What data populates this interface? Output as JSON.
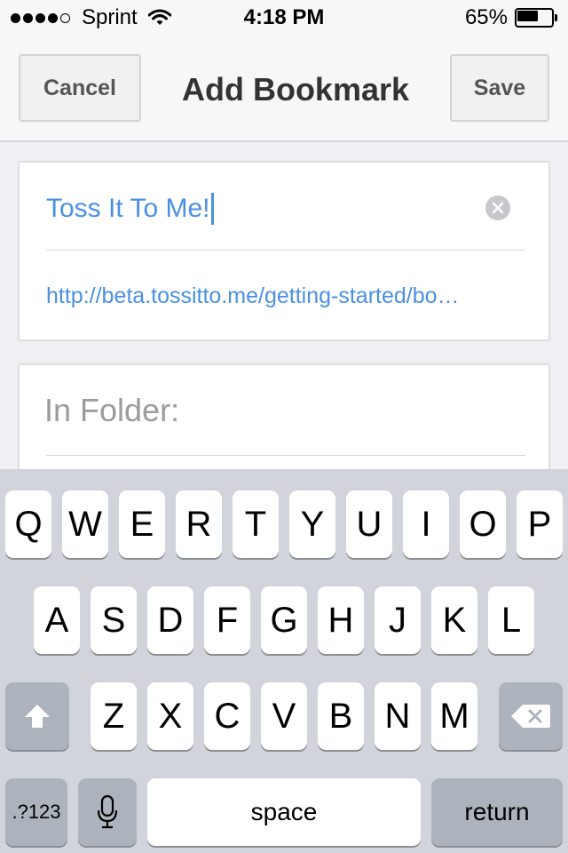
{
  "status_bar": {
    "carrier": "Sprint",
    "time": "4:18 PM",
    "battery_percent": "65%",
    "battery_level": 0.65,
    "signal_bars_filled": 4,
    "signal_bars_total": 5
  },
  "nav": {
    "cancel_label": "Cancel",
    "title": "Add Bookmark",
    "save_label": "Save"
  },
  "bookmark": {
    "title_value": "Toss It To Me!",
    "url_value": "http://beta.tossitto.me/getting-started/bo…"
  },
  "folder": {
    "label": "In Folder:"
  },
  "keyboard": {
    "row1": [
      "Q",
      "W",
      "E",
      "R",
      "T",
      "Y",
      "U",
      "I",
      "O",
      "P"
    ],
    "row2": [
      "A",
      "S",
      "D",
      "F",
      "G",
      "H",
      "J",
      "K",
      "L"
    ],
    "row3": [
      "Z",
      "X",
      "C",
      "V",
      "B",
      "N",
      "M"
    ],
    "numbers_label": ".?123",
    "space_label": "space",
    "return_label": "return",
    "shift_icon": "shift-icon",
    "delete_icon": "backspace-icon",
    "mic_icon": "microphone-icon"
  },
  "colors": {
    "accent": "#4a90e2",
    "keyboard_bg": "#d1d5db",
    "special_key": "#adb3bd"
  }
}
